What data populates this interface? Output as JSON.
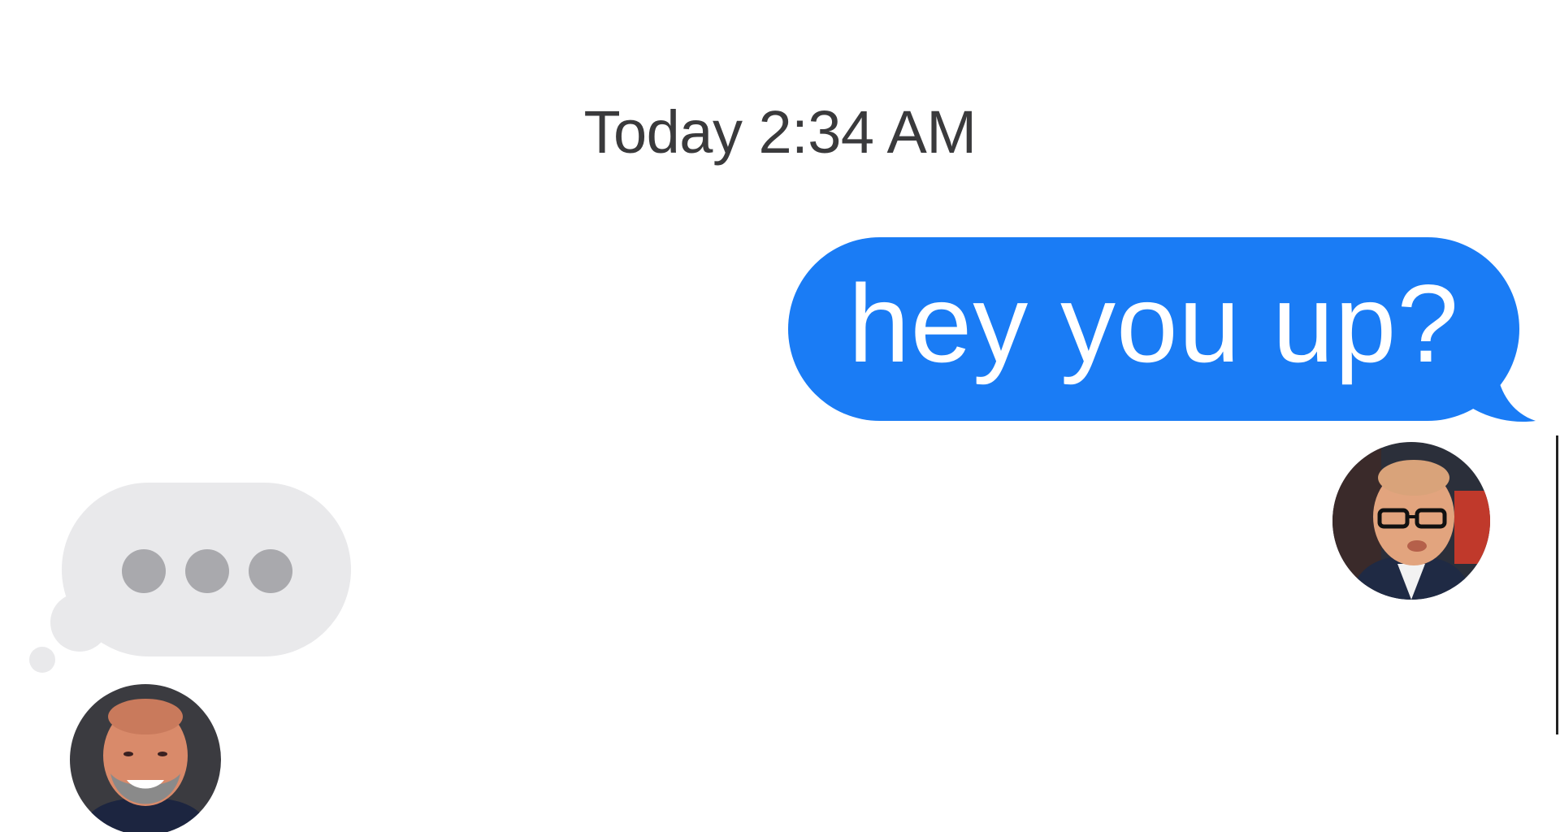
{
  "conversation": {
    "timestamp": "Today 2:34 AM",
    "messages": [
      {
        "direction": "outgoing",
        "text": "hey you up?"
      }
    ],
    "typing_indicator": {
      "visible": true,
      "dots": 3
    }
  },
  "participants": {
    "sender_avatar": "bald-man-glasses-avatar",
    "recipient_avatar": "smiling-bearded-man-avatar"
  },
  "colors": {
    "outgoing_bubble": "#1a7cf5",
    "typing_bubble": "#e9e9eb",
    "typing_dots": "#a9a9ad",
    "timestamp_text": "#3a3a3c",
    "background": "#ffffff"
  }
}
